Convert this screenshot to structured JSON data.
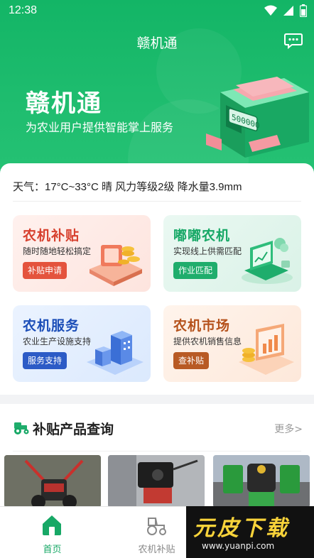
{
  "status_bar": {
    "time": "12:38"
  },
  "header": {
    "title": "赣机通"
  },
  "banner": {
    "title": "赣机通",
    "subtitle": "为农业用户提供智能掌上服务",
    "machine_number": "500000"
  },
  "weather": {
    "text": "天气：17°C~33°C 晴 风力等级2级 降水量3.9mm"
  },
  "tiles": [
    {
      "title": "农机补贴",
      "subtitle": "随时随地轻松搞定",
      "button": "补贴申请"
    },
    {
      "title": "嘟嘟农机",
      "subtitle": "实现线上供需匹配",
      "button": "作业匹配"
    },
    {
      "title": "农机服务",
      "subtitle": "农业生产设施支持",
      "button": "服务支持"
    },
    {
      "title": "农机市场",
      "subtitle": "提供农机销售信息",
      "button": "查补贴"
    }
  ],
  "products_section": {
    "title": "补贴产品查询",
    "more": "更多>"
  },
  "tabbar": {
    "home": "首页",
    "subsidy": "农机补贴"
  },
  "watermark": {
    "brand": "元皮下载",
    "url": "www.yuanpi.com"
  },
  "colors": {
    "primary": "#17a866",
    "red": "#e4533d",
    "blue": "#2c5bc6",
    "brown": "#b85a24"
  }
}
